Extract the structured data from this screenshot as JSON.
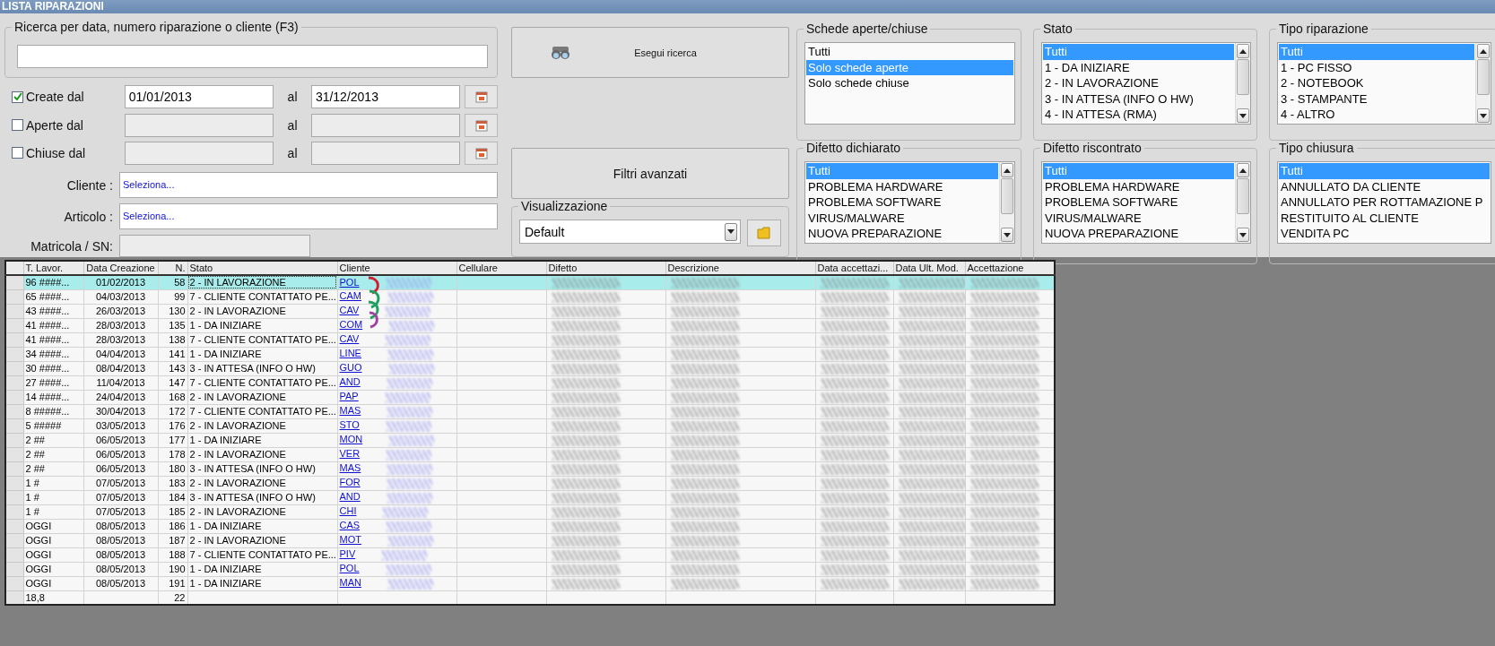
{
  "window": {
    "title": "LISTA RIPARAZIONI"
  },
  "search": {
    "legend": "Ricerca per data, numero riparazione o cliente (F3)"
  },
  "date_filters": [
    {
      "label": "Create dal",
      "checked": true,
      "from": "01/01/2013",
      "to_label": "al",
      "to": "31/12/2013"
    },
    {
      "label": "Aperte dal",
      "checked": false,
      "to_label": "al"
    },
    {
      "label": "Chiuse dal",
      "checked": false,
      "to_label": "al"
    }
  ],
  "lookups": [
    {
      "label": "Cliente :",
      "value": "Seleziona..."
    },
    {
      "label": "Articolo :",
      "value": "Seleziona..."
    }
  ],
  "serial": {
    "label": "Matricola / SN:"
  },
  "search_button": "Esegui ricerca",
  "advanced_button": "Filtri avanzati",
  "view": {
    "legend": "Visualizzazione",
    "value": "Default"
  },
  "filters": [
    {
      "title": "Schede aperte/chiuse",
      "scrollbar": false,
      "items": [
        {
          "label": "Tutti",
          "selected": false
        },
        {
          "label": "Solo schede aperte",
          "selected": true
        },
        {
          "label": "Solo schede chiuse",
          "selected": false
        }
      ]
    },
    {
      "title": "Stato",
      "scrollbar": true,
      "items": [
        {
          "label": "Tutti",
          "selected": true
        },
        {
          "label": "1 - DA INIZIARE",
          "selected": false
        },
        {
          "label": "2 - IN LAVORAZIONE",
          "selected": false
        },
        {
          "label": "3 - IN ATTESA (INFO O HW)",
          "selected": false
        },
        {
          "label": "4 - IN ATTESA (RMA)",
          "selected": false
        }
      ]
    },
    {
      "title": "Tipo riparazione",
      "scrollbar": true,
      "items": [
        {
          "label": "Tutti",
          "selected": true
        },
        {
          "label": "1 - PC FISSO",
          "selected": false
        },
        {
          "label": "2 - NOTEBOOK",
          "selected": false
        },
        {
          "label": "3 - STAMPANTE",
          "selected": false
        },
        {
          "label": "4 - ALTRO",
          "selected": false
        }
      ]
    },
    {
      "title": "Difetto dichiarato",
      "scrollbar": true,
      "items": [
        {
          "label": "Tutti",
          "selected": true
        },
        {
          "label": "PROBLEMA HARDWARE",
          "selected": false
        },
        {
          "label": "PROBLEMA SOFTWARE",
          "selected": false
        },
        {
          "label": "VIRUS/MALWARE",
          "selected": false
        },
        {
          "label": "NUOVA PREPARAZIONE",
          "selected": false
        }
      ]
    },
    {
      "title": "Difetto riscontrato",
      "scrollbar": true,
      "items": [
        {
          "label": "Tutti",
          "selected": true
        },
        {
          "label": "PROBLEMA HARDWARE",
          "selected": false
        },
        {
          "label": "PROBLEMA SOFTWARE",
          "selected": false
        },
        {
          "label": "VIRUS/MALWARE",
          "selected": false
        },
        {
          "label": "NUOVA PREPARAZIONE",
          "selected": false
        }
      ]
    },
    {
      "title": "Tipo chiusura",
      "scrollbar": false,
      "items": [
        {
          "label": "Tutti",
          "selected": true
        },
        {
          "label": "ANNULLATO DA CLIENTE",
          "selected": false
        },
        {
          "label": "ANNULLATO PER ROTTAMAZIONE P",
          "selected": false
        },
        {
          "label": "RESTITUITO AL CLIENTE",
          "selected": false
        },
        {
          "label": "VENDITA PC",
          "selected": false
        }
      ]
    }
  ],
  "table": {
    "columns": [
      {
        "label": "T. Lavor.",
        "kind": "text"
      },
      {
        "label": "Data Creazione",
        "kind": "center"
      },
      {
        "label": "N.",
        "kind": "number"
      },
      {
        "label": "Stato",
        "kind": "text"
      },
      {
        "label": "Cliente",
        "kind": "link"
      },
      {
        "label": "Cellulare",
        "kind": "text"
      },
      {
        "label": "Difetto",
        "kind": "redacted"
      },
      {
        "label": "Descrizione",
        "kind": "redacted"
      },
      {
        "label": "Data accettazi...",
        "kind": "redacted"
      },
      {
        "label": "Data Ult. Mod.",
        "kind": "redacted"
      },
      {
        "label": "Accettazione",
        "kind": "redacted"
      }
    ],
    "rows": [
      {
        "selected": true,
        "cells": [
          "96 ####...",
          "01/02/2013",
          "58",
          "2 - IN LAVORAZIONE",
          "POL"
        ]
      },
      {
        "selected": false,
        "cells": [
          "65 ####...",
          "04/03/2013",
          "99",
          "7 - CLIENTE CONTATTATO PE...",
          "CAM"
        ]
      },
      {
        "selected": false,
        "cells": [
          "43 ####...",
          "26/03/2013",
          "130",
          "2 - IN LAVORAZIONE",
          "CAV"
        ]
      },
      {
        "selected": false,
        "cells": [
          "41 ####...",
          "28/03/2013",
          "135",
          "1 - DA INIZIARE",
          "COM"
        ]
      },
      {
        "selected": false,
        "cells": [
          "41 ####...",
          "28/03/2013",
          "138",
          "7 - CLIENTE CONTATTATO PE...",
          "CAV"
        ]
      },
      {
        "selected": false,
        "cells": [
          "34 ####...",
          "04/04/2013",
          "141",
          "1 - DA INIZIARE",
          "LINE"
        ]
      },
      {
        "selected": false,
        "cells": [
          "30 ####...",
          "08/04/2013",
          "143",
          "3 - IN ATTESA (INFO O HW)",
          "GUO"
        ]
      },
      {
        "selected": false,
        "cells": [
          "27 ####...",
          "11/04/2013",
          "147",
          "7 - CLIENTE CONTATTATO PE...",
          "AND"
        ]
      },
      {
        "selected": false,
        "cells": [
          "14 ####...",
          "24/04/2013",
          "168",
          "2 - IN LAVORAZIONE",
          "PAP"
        ]
      },
      {
        "selected": false,
        "cells": [
          "8 #####...",
          "30/04/2013",
          "172",
          "7 - CLIENTE CONTATTATO PE...",
          "MAS"
        ]
      },
      {
        "selected": false,
        "cells": [
          "5 #####",
          "03/05/2013",
          "176",
          "2 - IN LAVORAZIONE",
          "STO"
        ]
      },
      {
        "selected": false,
        "cells": [
          "2 ##",
          "06/05/2013",
          "177",
          "1 - DA INIZIARE",
          "MON"
        ]
      },
      {
        "selected": false,
        "cells": [
          "2 ##",
          "06/05/2013",
          "178",
          "2 - IN LAVORAZIONE",
          "VER"
        ]
      },
      {
        "selected": false,
        "cells": [
          "2 ##",
          "06/05/2013",
          "180",
          "3 - IN ATTESA (INFO O HW)",
          "MAS"
        ]
      },
      {
        "selected": false,
        "cells": [
          "1 #",
          "07/05/2013",
          "183",
          "2 - IN LAVORAZIONE",
          "FOR"
        ]
      },
      {
        "selected": false,
        "cells": [
          "1 #",
          "07/05/2013",
          "184",
          "3 - IN ATTESA (INFO O HW)",
          "AND"
        ]
      },
      {
        "selected": false,
        "cells": [
          "1 #",
          "07/05/2013",
          "185",
          "2 - IN LAVORAZIONE",
          "CHI"
        ]
      },
      {
        "selected": false,
        "cells": [
          "OGGI",
          "08/05/2013",
          "186",
          "1 - DA INIZIARE",
          "CAS"
        ]
      },
      {
        "selected": false,
        "cells": [
          "OGGI",
          "08/05/2013",
          "187",
          "2 - IN LAVORAZIONE",
          "MOT"
        ]
      },
      {
        "selected": false,
        "cells": [
          "OGGI",
          "08/05/2013",
          "188",
          "7 - CLIENTE CONTATTATO PE...",
          "PIV"
        ]
      },
      {
        "selected": false,
        "cells": [
          "OGGI",
          "08/05/2013",
          "190",
          "1 - DA INIZIARE",
          "POL"
        ]
      },
      {
        "selected": false,
        "cells": [
          "OGGI",
          "08/05/2013",
          "191",
          "1 - DA INIZIARE",
          "MAN"
        ]
      }
    ],
    "totals": {
      "t_lavor": "18,8",
      "count": "22"
    }
  }
}
